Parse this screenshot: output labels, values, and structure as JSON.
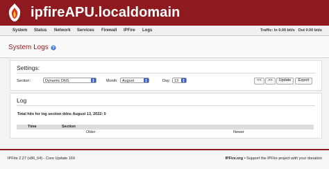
{
  "header": {
    "hostname": "ipfireAPU.localdomain",
    "logo_icon": "ipfire-flame-logo-icon",
    "brand_color": "#8e1a1f"
  },
  "nav": {
    "items": [
      "System",
      "Status",
      "Network",
      "Services",
      "Firewall",
      "IPFire",
      "Logs"
    ],
    "traffic_in": "Traffic: In 0.00 bit/s",
    "traffic_out": "Out 0.00 bit/s"
  },
  "page": {
    "title": "System Logs",
    "help_icon": "help-icon"
  },
  "settings": {
    "title": "Settings:",
    "section_label": "Section:",
    "section_value": "Dynamic DNS",
    "month_label": "Month:",
    "month_value": "August",
    "day_label": "Day:",
    "day_value": "13",
    "buttons": [
      "<<",
      ">>",
      "Update",
      "Export"
    ]
  },
  "log": {
    "title": "Log",
    "summary": "Total hits for log section ddns August 13, 2022: 0",
    "columns": [
      "Time",
      "Section"
    ],
    "older": "Older",
    "newer": "Newer"
  },
  "footer": {
    "version": "IPFire 2.27 (x86_64) - Core Update 169",
    "site": "IPFire.org",
    "support": " • Support the IPFire project with your donation"
  }
}
